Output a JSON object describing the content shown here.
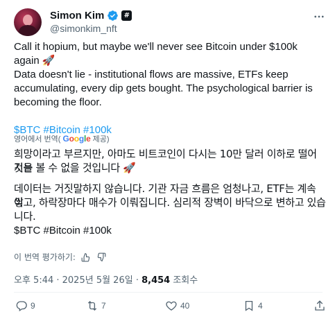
{
  "author": {
    "name": "Simon Kim",
    "handle": "@simonkim_nft",
    "affiliate_badge": "#"
  },
  "tweet": {
    "line1": "Call it hopium, but maybe we'll never see Bitcoin under $100k again 🚀",
    "line2": "Data doesn't lie - institutional flows are massive, ETFs keep accumulating, every dip gets bought. The psychological barrier is becoming the floor.",
    "hashtags": "$BTC #Bitcoin #100k"
  },
  "translation": {
    "label": "영어에서 번역(",
    "provider_g1": "G",
    "provider_o1": "o",
    "provider_o2": "o",
    "provider_g2": "g",
    "provider_l": "l",
    "provider_e": "e",
    "suffix": " 제공)",
    "para1_l1": "희망이라고 부르지만, 아마도 비트코인이 다시는 10만 달러 이하로 떨어지는",
    "para1_l2": "것을 볼 수 없을 것입니다 🚀",
    "para2_l1": "데이터는 거짓말하지 않습니다. 기관 자금 흐름은 엄청나고, ETF는 계속 쌓",
    "para2_l2": "이고, 하락장마다 매수가 이뤄집니다. 심리적 장벽이 바닥으로 변하고 있습",
    "para2_l3": "니다.",
    "hashtags": "$BTC #Bitcoin #100k",
    "rate_label": "이 번역 평가하기:"
  },
  "meta": {
    "time": "오후 5:44 · 2025년 5월 26일 · ",
    "views": "8,454",
    "views_label": " 조회수"
  },
  "actions": {
    "replies": "9",
    "reposts": "7",
    "likes": "40",
    "bookmarks": "4"
  },
  "colors": {
    "accent": "#1d9bf0",
    "text": "#0f1419",
    "secondary": "#536471"
  }
}
